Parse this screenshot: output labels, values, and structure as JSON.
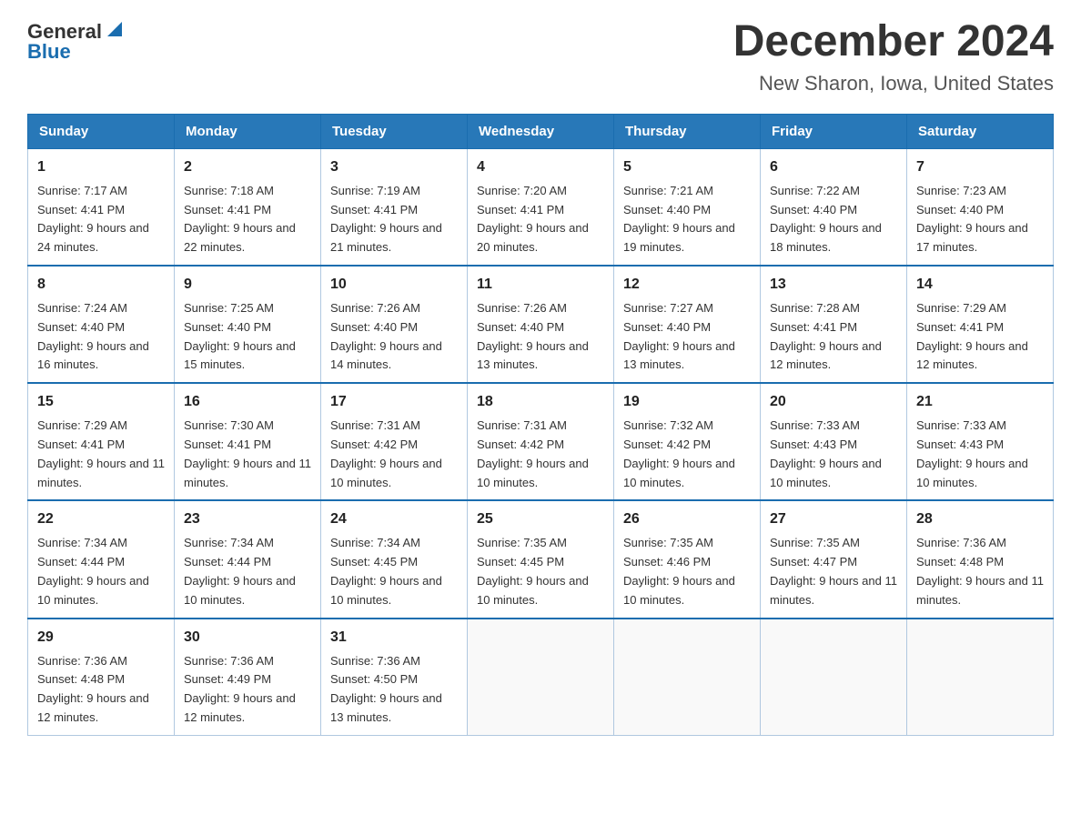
{
  "logo": {
    "text_general": "General",
    "text_blue": "Blue",
    "line2": "Blue"
  },
  "header": {
    "month_title": "December 2024",
    "location": "New Sharon, Iowa, United States"
  },
  "days_of_week": [
    "Sunday",
    "Monday",
    "Tuesday",
    "Wednesday",
    "Thursday",
    "Friday",
    "Saturday"
  ],
  "weeks": [
    [
      {
        "num": "1",
        "sunrise": "7:17 AM",
        "sunset": "4:41 PM",
        "daylight": "9 hours and 24 minutes."
      },
      {
        "num": "2",
        "sunrise": "7:18 AM",
        "sunset": "4:41 PM",
        "daylight": "9 hours and 22 minutes."
      },
      {
        "num": "3",
        "sunrise": "7:19 AM",
        "sunset": "4:41 PM",
        "daylight": "9 hours and 21 minutes."
      },
      {
        "num": "4",
        "sunrise": "7:20 AM",
        "sunset": "4:41 PM",
        "daylight": "9 hours and 20 minutes."
      },
      {
        "num": "5",
        "sunrise": "7:21 AM",
        "sunset": "4:40 PM",
        "daylight": "9 hours and 19 minutes."
      },
      {
        "num": "6",
        "sunrise": "7:22 AM",
        "sunset": "4:40 PM",
        "daylight": "9 hours and 18 minutes."
      },
      {
        "num": "7",
        "sunrise": "7:23 AM",
        "sunset": "4:40 PM",
        "daylight": "9 hours and 17 minutes."
      }
    ],
    [
      {
        "num": "8",
        "sunrise": "7:24 AM",
        "sunset": "4:40 PM",
        "daylight": "9 hours and 16 minutes."
      },
      {
        "num": "9",
        "sunrise": "7:25 AM",
        "sunset": "4:40 PM",
        "daylight": "9 hours and 15 minutes."
      },
      {
        "num": "10",
        "sunrise": "7:26 AM",
        "sunset": "4:40 PM",
        "daylight": "9 hours and 14 minutes."
      },
      {
        "num": "11",
        "sunrise": "7:26 AM",
        "sunset": "4:40 PM",
        "daylight": "9 hours and 13 minutes."
      },
      {
        "num": "12",
        "sunrise": "7:27 AM",
        "sunset": "4:40 PM",
        "daylight": "9 hours and 13 minutes."
      },
      {
        "num": "13",
        "sunrise": "7:28 AM",
        "sunset": "4:41 PM",
        "daylight": "9 hours and 12 minutes."
      },
      {
        "num": "14",
        "sunrise": "7:29 AM",
        "sunset": "4:41 PM",
        "daylight": "9 hours and 12 minutes."
      }
    ],
    [
      {
        "num": "15",
        "sunrise": "7:29 AM",
        "sunset": "4:41 PM",
        "daylight": "9 hours and 11 minutes."
      },
      {
        "num": "16",
        "sunrise": "7:30 AM",
        "sunset": "4:41 PM",
        "daylight": "9 hours and 11 minutes."
      },
      {
        "num": "17",
        "sunrise": "7:31 AM",
        "sunset": "4:42 PM",
        "daylight": "9 hours and 10 minutes."
      },
      {
        "num": "18",
        "sunrise": "7:31 AM",
        "sunset": "4:42 PM",
        "daylight": "9 hours and 10 minutes."
      },
      {
        "num": "19",
        "sunrise": "7:32 AM",
        "sunset": "4:42 PM",
        "daylight": "9 hours and 10 minutes."
      },
      {
        "num": "20",
        "sunrise": "7:33 AM",
        "sunset": "4:43 PM",
        "daylight": "9 hours and 10 minutes."
      },
      {
        "num": "21",
        "sunrise": "7:33 AM",
        "sunset": "4:43 PM",
        "daylight": "9 hours and 10 minutes."
      }
    ],
    [
      {
        "num": "22",
        "sunrise": "7:34 AM",
        "sunset": "4:44 PM",
        "daylight": "9 hours and 10 minutes."
      },
      {
        "num": "23",
        "sunrise": "7:34 AM",
        "sunset": "4:44 PM",
        "daylight": "9 hours and 10 minutes."
      },
      {
        "num": "24",
        "sunrise": "7:34 AM",
        "sunset": "4:45 PM",
        "daylight": "9 hours and 10 minutes."
      },
      {
        "num": "25",
        "sunrise": "7:35 AM",
        "sunset": "4:45 PM",
        "daylight": "9 hours and 10 minutes."
      },
      {
        "num": "26",
        "sunrise": "7:35 AM",
        "sunset": "4:46 PM",
        "daylight": "9 hours and 10 minutes."
      },
      {
        "num": "27",
        "sunrise": "7:35 AM",
        "sunset": "4:47 PM",
        "daylight": "9 hours and 11 minutes."
      },
      {
        "num": "28",
        "sunrise": "7:36 AM",
        "sunset": "4:48 PM",
        "daylight": "9 hours and 11 minutes."
      }
    ],
    [
      {
        "num": "29",
        "sunrise": "7:36 AM",
        "sunset": "4:48 PM",
        "daylight": "9 hours and 12 minutes."
      },
      {
        "num": "30",
        "sunrise": "7:36 AM",
        "sunset": "4:49 PM",
        "daylight": "9 hours and 12 minutes."
      },
      {
        "num": "31",
        "sunrise": "7:36 AM",
        "sunset": "4:50 PM",
        "daylight": "9 hours and 13 minutes."
      },
      null,
      null,
      null,
      null
    ]
  ]
}
